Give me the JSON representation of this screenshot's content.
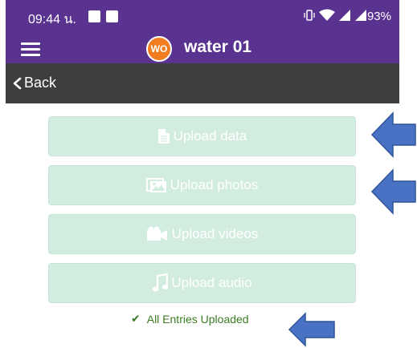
{
  "status_bar": {
    "time": "09:44 น.",
    "battery": "93%"
  },
  "app_bar": {
    "badge": "WO",
    "title": "water 01"
  },
  "nav": {
    "back_label": "Back"
  },
  "actions": [
    {
      "label": "Upload data",
      "icon": "document-icon"
    },
    {
      "label": "Upload photos",
      "icon": "photos-icon"
    },
    {
      "label": "Upload videos",
      "icon": "video-camera-icon"
    },
    {
      "label": "Upload audio",
      "icon": "music-note-icon"
    }
  ],
  "upload_status": "All Entries Uploaded",
  "colors": {
    "app_bar": "#5a3391",
    "badge": "#f27d21",
    "nav_bar": "#3e3e3e",
    "button_disabled": "#d3ece0",
    "status_text": "#3a7d25",
    "arrow": "#4a72c4"
  }
}
